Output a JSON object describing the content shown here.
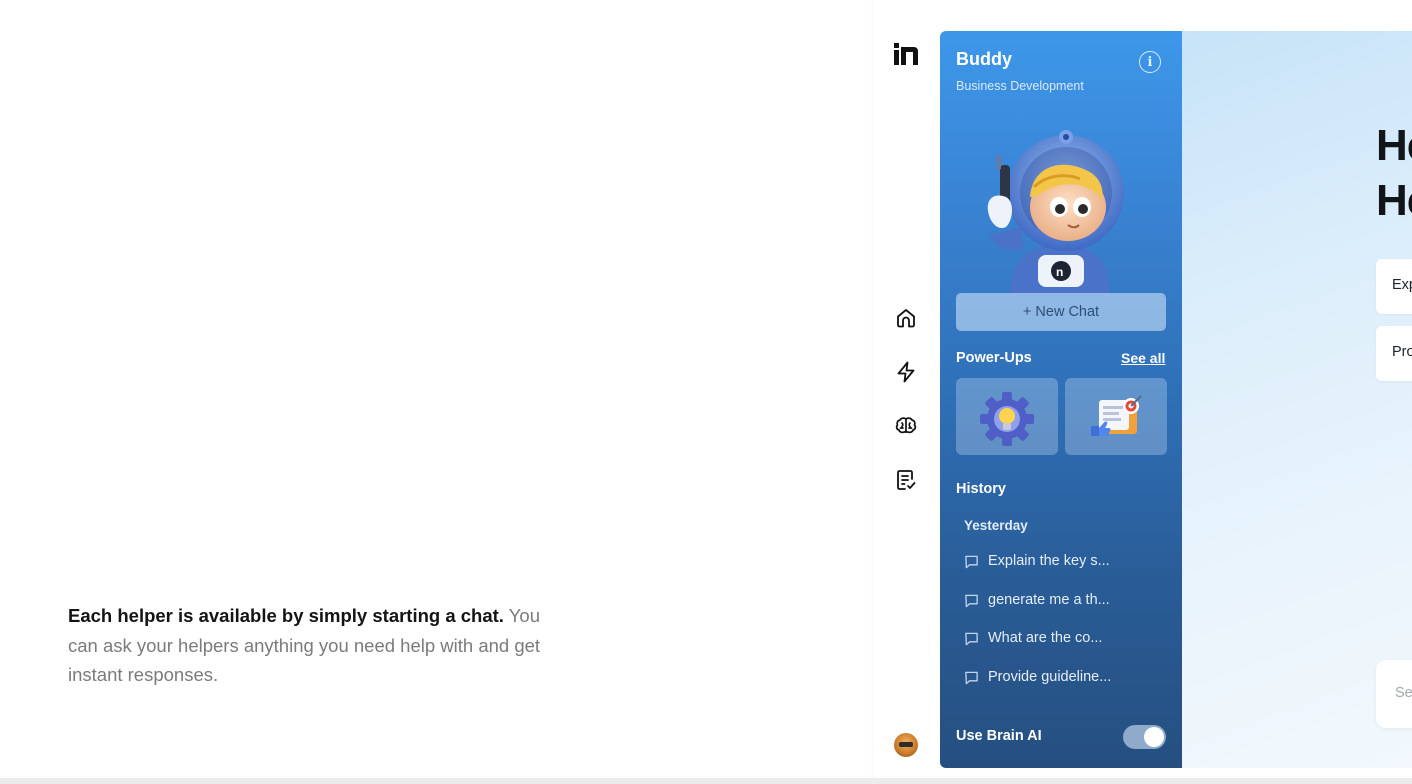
{
  "caption": {
    "strong": "Each helper is available by simply starting a chat.",
    "rest": " You can ask your helpers anything you need help with and get instant responses."
  },
  "rail": {
    "icons": [
      "home-icon",
      "lightning-icon",
      "brain-icon",
      "checklist-icon"
    ]
  },
  "panel": {
    "title": "Buddy",
    "subtitle": "Business Development",
    "new_chat_label": "+ New Chat",
    "powerups_label": "Power-Ups",
    "see_all_label": "See all",
    "history_label": "History",
    "history_date": "Yesterday",
    "history_items": [
      "Explain the key s...",
      "generate me a th...",
      "What are the co...",
      "Provide guideline..."
    ],
    "brain_label": "Use Brain AI",
    "brain_enabled": true
  },
  "main": {
    "greeting_line1": "He",
    "greeting_line2": "He",
    "suggestions": [
      "Exp",
      "Pro"
    ],
    "search_placeholder": "Se"
  },
  "colors": {
    "panel_top": "#3d97e9",
    "panel_bottom": "#264f80",
    "caption_strong": "#141414",
    "caption_muted": "#7b7b7b"
  }
}
